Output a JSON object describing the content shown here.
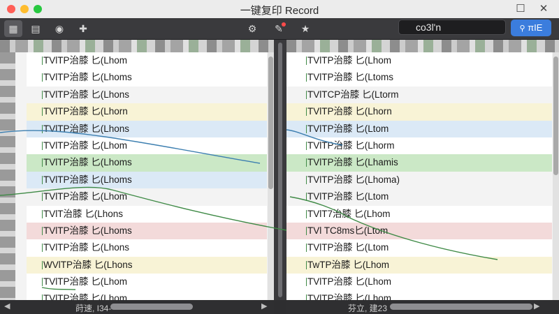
{
  "window": {
    "title": "一键复印 Record"
  },
  "toolbar": {
    "tools": [
      "layout-icon",
      "save-icon",
      "camera-icon",
      "crop-move-icon"
    ],
    "center_tools": [
      "gear-icon",
      "pen-badge-icon",
      "star-icon"
    ]
  },
  "search": {
    "value": "co3l'n",
    "button_label": "πIE"
  },
  "left_pane": {
    "rows": [
      {
        "label": "TVlTP治膝 匕(Lhom",
        "style": "alt"
      },
      {
        "label": "TVlTP治膝 匕(Lhoms",
        "style": "alt"
      },
      {
        "label": "TVlTP治膝 匕(Lhons",
        "style": "plain"
      },
      {
        "label": "TVlTP治膝 匕(Lhorn",
        "style": "yellow"
      },
      {
        "label": "TVlTP治膝 匕(Lhons",
        "style": "blue"
      },
      {
        "label": "TVlTP治膝 匕(Lhom",
        "style": "alt"
      },
      {
        "label": "TVlTP治膝 匕(Lhoms",
        "style": "green"
      },
      {
        "label": "TVlTP治膝 匕(Lhoms",
        "style": "blue"
      },
      {
        "label": "TVlTP治膝 匕(Lhom",
        "style": "plain"
      },
      {
        "label": "TVlT治膝 匕(Lhons",
        "style": "alt"
      },
      {
        "label": "TVlTP治膝 匕(Lhoms",
        "style": "pink"
      },
      {
        "label": "TVlTP治膝 匕(Lhons",
        "style": "alt"
      },
      {
        "label": "WVlTP治膝 匕(Lhons",
        "style": "yellow"
      },
      {
        "label": "TVlTP治膝 匕(Lhom",
        "style": "alt"
      },
      {
        "label": "TVlTP治膝 匕(Lhom",
        "style": "alt"
      }
    ],
    "status_label": "莳速, I34-"
  },
  "right_pane": {
    "rows": [
      {
        "label": "TVlTP治膝 匕(Lhom",
        "style": "alt"
      },
      {
        "label": "TVlTP治膝 匕(Ltoms",
        "style": "alt"
      },
      {
        "label": "TVlTCP治膝 匕(Ltorm",
        "style": "plain"
      },
      {
        "label": "TVlTP治膝 匕(Lhorn",
        "style": "yellow"
      },
      {
        "label": "TVlTP治膝 匕(Ltom",
        "style": "blue"
      },
      {
        "label": "TVlTP治膝 匕(Lhorm",
        "style": "alt"
      },
      {
        "label": "TVlTP治膝 匕(Lhamis",
        "style": "green"
      },
      {
        "label": "TVlTP治膝 匕(Lhoma)",
        "style": "plain"
      },
      {
        "label": "TVlTP治膝 匕(Ltom",
        "style": "plain"
      },
      {
        "label": "TVlT7治膝 匕(Lhom",
        "style": "alt"
      },
      {
        "label": "TVl TC8ms匕(Ltom",
        "style": "pink"
      },
      {
        "label": "TVlTP治膝 匕(Ltom",
        "style": "alt"
      },
      {
        "label": "TwTP治膝 匕(Lhom",
        "style": "yellow"
      },
      {
        "label": "TVlTP治膝 匕(Lhom",
        "style": "alt"
      },
      {
        "label": "TVlTP治膝 匕(Lhom",
        "style": "alt"
      }
    ],
    "status_label": "芬立, 建23"
  },
  "colors": {
    "accent": "#3b7ddd",
    "green_line": "#3f8a46",
    "blue_line": "#3d7fb0"
  }
}
